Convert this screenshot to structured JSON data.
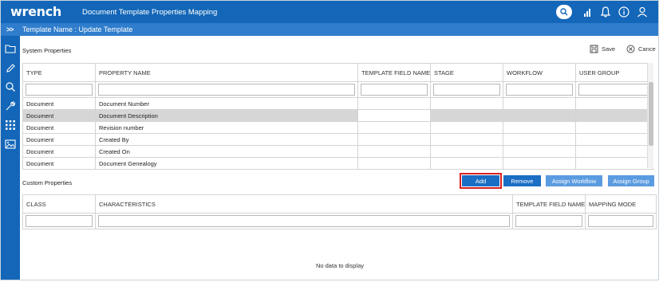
{
  "app": {
    "logo": "wrench",
    "title": "Document Template Properties Mapping"
  },
  "subheader": {
    "expand_label": ">>",
    "template_name": "Template Name : Update Template"
  },
  "toolbar": {
    "save_label": "Save",
    "cancel_label": "Cance"
  },
  "system_properties": {
    "title": "System Properties",
    "columns": [
      "TYPE",
      "PROPERTY NAME",
      "TEMPLATE FIELD NAME",
      "STAGE",
      "WORKFLOW",
      "USER GROUP"
    ],
    "rows": [
      [
        "Document",
        "Document Number"
      ],
      [
        "Document",
        "Document Description"
      ],
      [
        "Document",
        "Revision number"
      ],
      [
        "Document",
        "Created By"
      ],
      [
        "Document",
        "Created On"
      ],
      [
        "Document",
        "Document Genealogy"
      ]
    ],
    "selected_row": 1
  },
  "custom_properties": {
    "title": "Custom Properties",
    "buttons": {
      "add": "Add",
      "remove": "Remove",
      "assign_workflow": "Assign Workflow",
      "assign_group": "Assign Group"
    },
    "columns": [
      "CLASS",
      "CHARACTERISTICS",
      "TEMPLATE FIELD NAME",
      "MAPPING MODE"
    ],
    "empty_message": "No data to display"
  },
  "icons": {
    "top": [
      "search-icon",
      "signal-icon",
      "bell-icon",
      "info-icon",
      "user-icon"
    ],
    "rail": [
      "folder-icon",
      "pencil-icon",
      "search-icon",
      "wrench-icon",
      "grid-icon",
      "image-icon"
    ]
  },
  "colors": {
    "header": "#1467b8",
    "subheader": "#2f7dcc",
    "primary_button": "#1a6ec4",
    "secondary_button": "#5b9be0",
    "highlight": "#d92020",
    "selected_row": "#d6d6d6"
  }
}
